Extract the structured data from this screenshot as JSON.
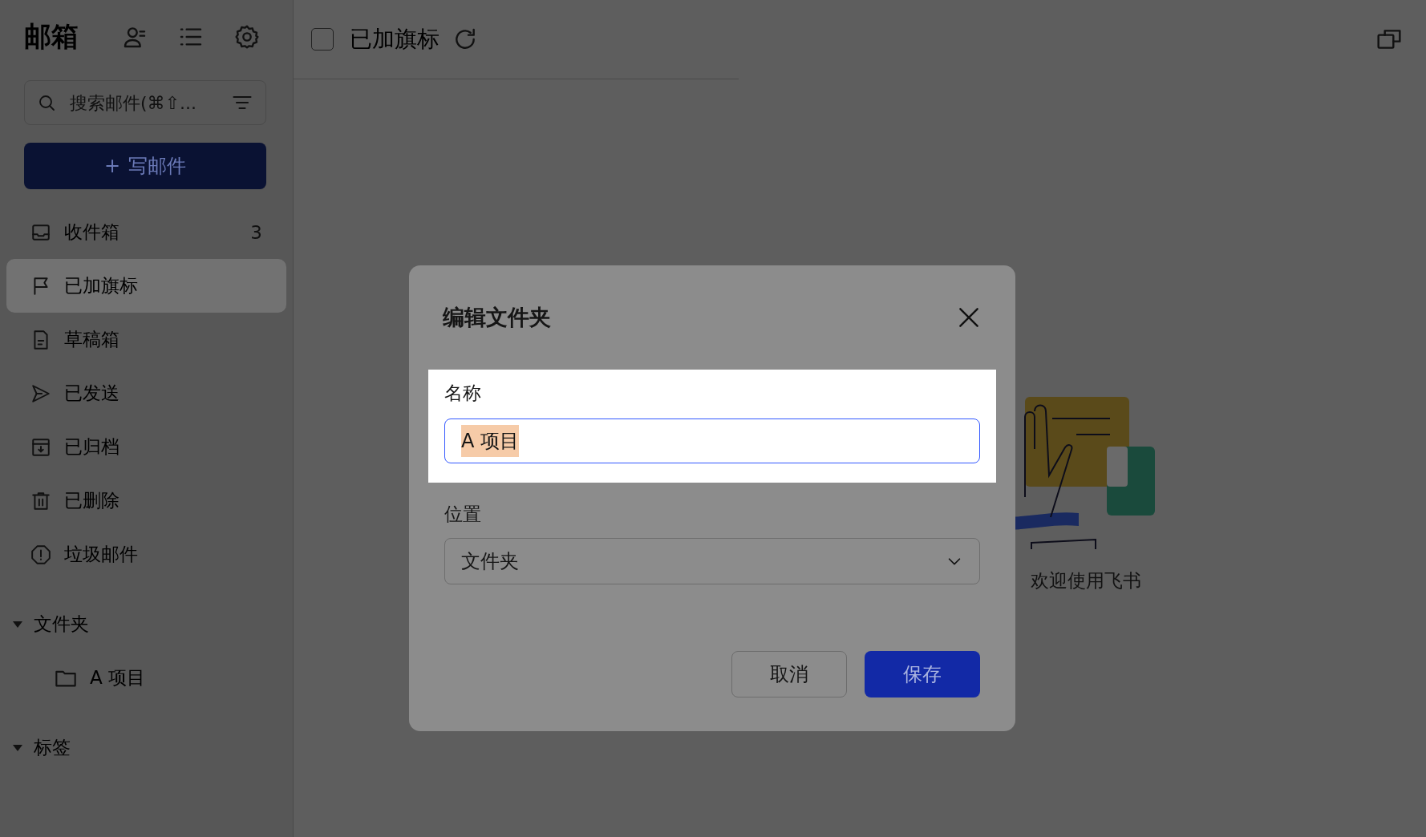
{
  "sidebar": {
    "title": "邮箱",
    "search": {
      "placeholder": "搜索邮件(⌘⇧..."
    },
    "compose": {
      "icon": "+",
      "label": "写邮件"
    },
    "items": [
      {
        "label": "收件箱",
        "count": "3",
        "selected": false
      },
      {
        "label": "已加旗标",
        "selected": true
      },
      {
        "label": "草稿箱",
        "selected": false
      },
      {
        "label": "已发送",
        "selected": false
      },
      {
        "label": "已归档",
        "selected": false
      },
      {
        "label": "已删除",
        "selected": false
      },
      {
        "label": "垃圾邮件",
        "selected": false
      }
    ],
    "folders": {
      "label": "文件夹",
      "expanded": true,
      "children": [
        {
          "label": "A 项目"
        }
      ]
    },
    "tags": {
      "label": "标签",
      "expanded": true
    }
  },
  "toolbar": {
    "checked": false,
    "title": "已加旗标"
  },
  "welcome": {
    "text": "欢迎使用飞书"
  },
  "dialog": {
    "title": "编辑文件夹",
    "name_label": "名称",
    "name_value": "A 项目",
    "name_value_selected": true,
    "location_label": "位置",
    "location_value": "文件夹",
    "buttons": [
      {
        "kind": "secondary",
        "label": "取消"
      },
      {
        "kind": "primary",
        "label": "保存"
      }
    ]
  }
}
